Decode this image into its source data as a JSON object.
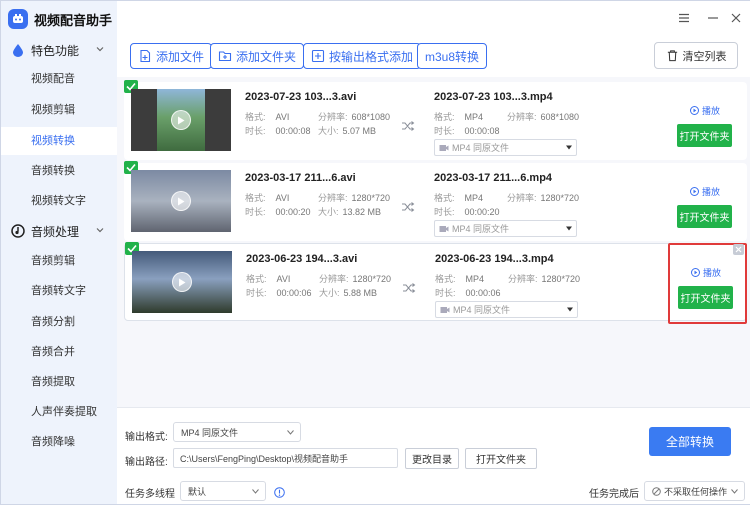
{
  "app": {
    "title": "视频配音助手"
  },
  "sidebar": {
    "groups": [
      {
        "label": "特色功能",
        "items": [
          "视频配音",
          "视频剪辑",
          "视频转换",
          "音频转换",
          "视频转文字"
        ]
      },
      {
        "label": "音频处理",
        "items": [
          "音频剪辑",
          "音频转文字",
          "音频分割",
          "音频合并",
          "音频提取",
          "人声伴奏提取",
          "音频降噪"
        ]
      }
    ],
    "active_item": "视频转换"
  },
  "toolbar": {
    "add_file": "添加文件",
    "add_folder": "添加文件夹",
    "add_by_format": "按输出格式添加",
    "m3u8": "m3u8转换",
    "clear_list": "清空列表"
  },
  "labels": {
    "format": "格式:",
    "resolution": "分辨率:",
    "duration": "时长:",
    "size": "大小:",
    "play": "播放",
    "open_folder": "打开文件夹"
  },
  "files": [
    {
      "src_name": "2023-07-23 103...3.avi",
      "src_format": "AVI",
      "src_res": "608*1080",
      "src_dur": "00:00:08",
      "src_size": "5.07 MB",
      "out_name": "2023-07-23 103...3.mp4",
      "out_format": "MP4",
      "out_res": "608*1080",
      "out_dur": "00:00:08",
      "out_select": "MP4  同原文件"
    },
    {
      "src_name": "2023-03-17 211...6.avi",
      "src_format": "AVI",
      "src_res": "1280*720",
      "src_dur": "00:00:20",
      "src_size": "13.82 MB",
      "out_name": "2023-03-17 211...6.mp4",
      "out_format": "MP4",
      "out_res": "1280*720",
      "out_dur": "00:00:20",
      "out_select": "MP4  同原文件"
    },
    {
      "src_name": "2023-06-23 194...3.avi",
      "src_format": "AVI",
      "src_res": "1280*720",
      "src_dur": "00:00:06",
      "src_size": "5.88 MB",
      "out_name": "2023-06-23 194...3.mp4",
      "out_format": "MP4",
      "out_res": "1280*720",
      "out_dur": "00:00:06",
      "out_select": "MP4  同原文件"
    }
  ],
  "bottom": {
    "output_format_label": "输出格式:",
    "output_format_value": "MP4  同原文件",
    "output_path_label": "输出路径:",
    "output_path_value": "C:\\Users\\FengPing\\Desktop\\视频配音助手",
    "change_dir": "更改目录",
    "open_folder": "打开文件夹",
    "threads_label": "任务多线程",
    "threads_value": "默认",
    "after_done_label": "任务完成后",
    "after_done_value": "不采取任何操作",
    "convert_all": "全部转换"
  },
  "colors": {
    "accent": "#3a6ff0",
    "success": "#21b24a",
    "highlight": "#e03a3a",
    "sidebar_bg": "#eef3fc"
  }
}
